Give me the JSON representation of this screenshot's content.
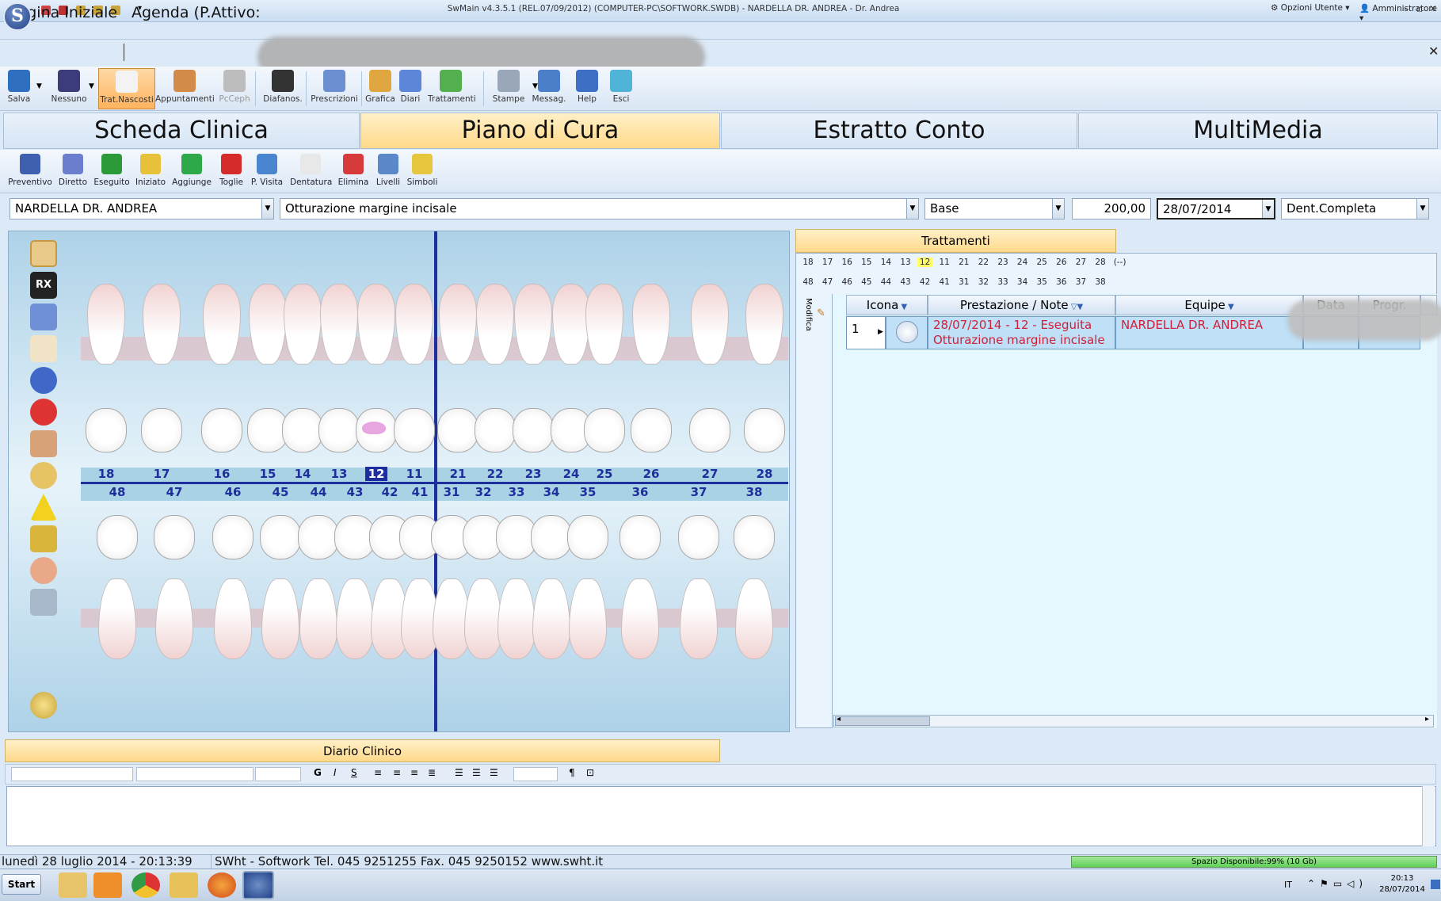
{
  "titlebar": {
    "logo": "S",
    "title": "SwMain v4.3.5.1 (REL.07/09/2012) (COMPUTER-PC\\SOFTWORK.SWDB) - NARDELLA DR. ANDREA - Dr. Andrea"
  },
  "optbar": {
    "opzioni": "Opzioni Utente",
    "admin": "Amministratore"
  },
  "pagetabs": {
    "home": "Pagina Iniziale",
    "agenda": "Agenda (P.Attivo:"
  },
  "toolbar": [
    {
      "label": "Salva",
      "icon": "save-icon",
      "color": "#2f6fbf"
    },
    {
      "label": "Nessuno",
      "icon": "film-icon",
      "color": "#3c3c7a"
    },
    {
      "label": "Trat.Nascosti",
      "icon": "tooth-icon",
      "color": "#f3f3f3"
    },
    {
      "label": "Appuntamenti",
      "icon": "appointments-icon",
      "color": "#d38b4a"
    },
    {
      "label": "PcCeph",
      "icon": "skull-icon",
      "color": "#bdbdbd"
    },
    {
      "label": "Diafanos.",
      "icon": "monitor-icon",
      "color": "#333333"
    },
    {
      "label": "Prescrizioni",
      "icon": "pen-icon",
      "color": "#6c8fd1"
    },
    {
      "label": "Grafica",
      "icon": "zoom-icon",
      "color": "#e0a740"
    },
    {
      "label": "Diari",
      "icon": "zoom-icon",
      "color": "#5d86d8"
    },
    {
      "label": "Trattamenti",
      "icon": "zoom-icon",
      "color": "#52b04f"
    },
    {
      "label": "Stampe",
      "icon": "printer-icon",
      "color": "#9aa7b8"
    },
    {
      "label": "Messag.",
      "icon": "messages-icon",
      "color": "#4c7fc9"
    },
    {
      "label": "Help",
      "icon": "help-icon",
      "color": "#3d70c5"
    },
    {
      "label": "Esci",
      "icon": "exit-icon",
      "color": "#4fb4d8"
    }
  ],
  "sections": {
    "scheda": "Scheda Clinica",
    "piano": "Piano di Cura",
    "estratto": "Estratto Conto",
    "multimedia": "MultiMedia"
  },
  "toolbar2": [
    {
      "label": "Preventivo",
      "icon": "calculator-icon",
      "color": "#3f5fb0"
    },
    {
      "label": "Diretto",
      "icon": "direct-icon",
      "color": "#6c7fcf"
    },
    {
      "label": "Eseguito",
      "icon": "check-icon",
      "color": "#2d9a3a"
    },
    {
      "label": "Iniziato",
      "icon": "started-icon",
      "color": "#e8c13a"
    },
    {
      "label": "Aggiunge",
      "icon": "plus-icon",
      "color": "#2fa84a"
    },
    {
      "label": "Toglie",
      "icon": "minus-icon",
      "color": "#d62b2b"
    },
    {
      "label": "P. Visita",
      "icon": "document-icon",
      "color": "#4a86cf"
    },
    {
      "label": "Dentatura",
      "icon": "tooth-icon",
      "color": "#e8e8e8"
    },
    {
      "label": "Elimina",
      "icon": "delete-icon",
      "color": "#d63a3a"
    },
    {
      "label": "Livelli",
      "icon": "layers-icon",
      "color": "#5a88c9"
    },
    {
      "label": "Simboli",
      "icon": "symbols-icon",
      "color": "#e6c63c"
    }
  ],
  "fields": {
    "dentist": "NARDELLA DR. ANDREA",
    "treatment": "Otturazione margine incisale",
    "listino": "Base",
    "price": "200,00",
    "date": "28/07/2014",
    "dentition": "Dent.Completa"
  },
  "chart": {
    "upper": [
      "18",
      "17",
      "16",
      "15",
      "14",
      "13",
      "12",
      "11",
      "21",
      "22",
      "23",
      "24",
      "25",
      "26",
      "27",
      "28"
    ],
    "lower": [
      "48",
      "47",
      "46",
      "45",
      "44",
      "43",
      "42",
      "41",
      "31",
      "32",
      "33",
      "34",
      "35",
      "36",
      "37",
      "38"
    ],
    "selected": "12"
  },
  "trattamenti": {
    "title": "Trattamenti",
    "upper": [
      "18",
      "17",
      "16",
      "15",
      "14",
      "13",
      "12",
      "11",
      "21",
      "22",
      "23",
      "24",
      "25",
      "26",
      "27",
      "28",
      "(--)"
    ],
    "lower": [
      "48",
      "47",
      "46",
      "45",
      "44",
      "43",
      "42",
      "41",
      "31",
      "32",
      "33",
      "34",
      "35",
      "36",
      "37",
      "38"
    ],
    "modifica": "Modifica",
    "headers": {
      "icona": "Icona",
      "prestazione": "Prestazione / Note",
      "equipe": "Equipe",
      "data": "Data",
      "prog": "Progr."
    },
    "rows": [
      {
        "n": "1",
        "line1": "28/07/2014 - 12 - Eseguita",
        "line2": "Otturazione margine incisale",
        "equipe": "NARDELLA DR. ANDREA"
      }
    ]
  },
  "diario": {
    "title": "Diario Clinico"
  },
  "status": {
    "date": "lunedì 28 luglio 2014 - 20:13:39",
    "info": "SWht - Softwork Tel. 045 9251255 Fax. 045 9250152 www.swht.it",
    "space": "Spazio Disponibile:99% (10 Gb)"
  },
  "taskbar": {
    "start": "Start",
    "lang": "IT",
    "time": "20:13",
    "date": "28/07/2014"
  }
}
